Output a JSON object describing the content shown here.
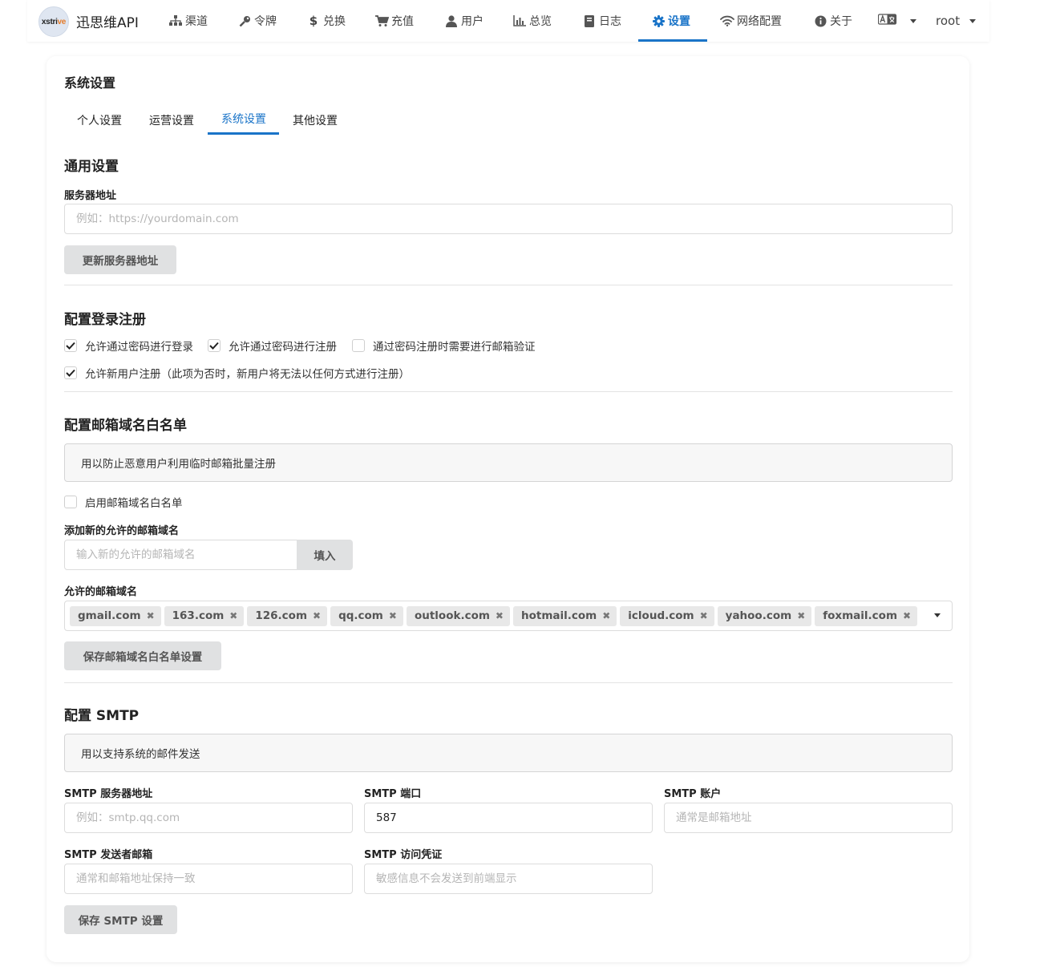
{
  "nav": {
    "logo_text_1": "xstri",
    "logo_text_2": "ve",
    "brand": "迅思维API",
    "items": [
      {
        "label": "渠道",
        "icon": "sitemap-icon"
      },
      {
        "label": "令牌",
        "icon": "key-icon"
      },
      {
        "label": "兑换",
        "icon": "dollar-icon"
      },
      {
        "label": "充值",
        "icon": "cart-icon"
      },
      {
        "label": "用户",
        "icon": "user-icon"
      },
      {
        "label": "总览",
        "icon": "bar-chart-icon"
      },
      {
        "label": "日志",
        "icon": "book-icon"
      },
      {
        "label": "设置",
        "icon": "gear-icon"
      },
      {
        "label": "网络配置",
        "icon": "wifi-icon"
      },
      {
        "label": "关于",
        "icon": "info-icon"
      }
    ],
    "active": "设置",
    "user": "root",
    "accent_color": "#1a74c8"
  },
  "page": {
    "title": "系统设置",
    "tabs": [
      "个人设置",
      "运营设置",
      "系统设置",
      "其他设置"
    ],
    "active_tab": "系统设置"
  },
  "general": {
    "title": "通用设置",
    "server_label": "服务器地址",
    "server_placeholder": "例如：https://yourdomain.com",
    "server_value": "",
    "update_button": "更新服务器地址"
  },
  "login": {
    "title": "配置登录注册",
    "options": [
      {
        "label": "允许通过密码进行登录",
        "checked": true
      },
      {
        "label": "允许通过密码进行注册",
        "checked": true
      },
      {
        "label": "通过密码注册时需要进行邮箱验证",
        "checked": false
      },
      {
        "label": "允许新用户注册（此项为否时，新用户将无法以任何方式进行注册）",
        "checked": true
      }
    ]
  },
  "whitelist": {
    "title": "配置邮箱域名白名单",
    "message": "用以防止恶意用户利用临时邮箱批量注册",
    "enable_label": "启用邮箱域名白名单",
    "enable_checked": false,
    "add_label": "添加新的允许的邮箱域名",
    "add_placeholder": "输入新的允许的邮箱域名",
    "add_button": "填入",
    "allowed_label": "允许的邮箱域名",
    "domains": [
      "gmail.com",
      "163.com",
      "126.com",
      "qq.com",
      "outlook.com",
      "hotmail.com",
      "icloud.com",
      "yahoo.com",
      "foxmail.com"
    ],
    "save_button": "保存邮箱域名白名单设置"
  },
  "smtp": {
    "title": "配置 SMTP",
    "message": "用以支持系统的邮件发送",
    "server_label": "SMTP 服务器地址",
    "server_placeholder": "例如：smtp.qq.com",
    "port_label": "SMTP 端口",
    "port_value": "587",
    "account_label": "SMTP 账户",
    "account_placeholder": "通常是邮箱地址",
    "from_label": "SMTP 发送者邮箱",
    "from_placeholder": "通常和邮箱地址保持一致",
    "token_label": "SMTP 访问凭证",
    "token_placeholder": "敏感信息不会发送到前端显示",
    "save_button": "保存 SMTP 设置"
  }
}
